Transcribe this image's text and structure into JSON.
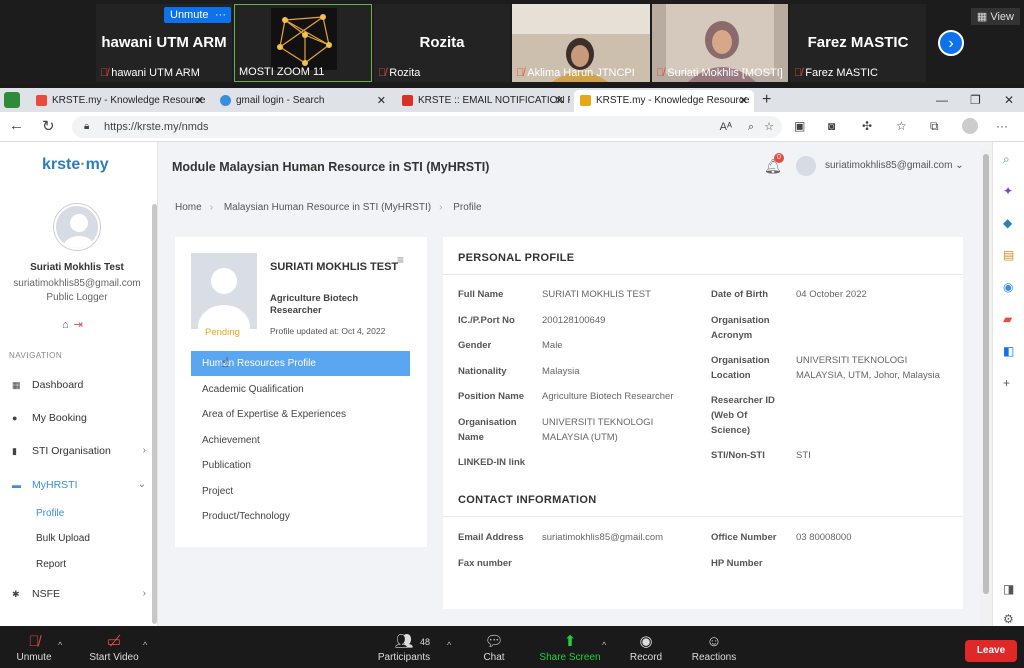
{
  "zoom_gallery": {
    "unmute_label": "Unmute",
    "more_label": "···",
    "view_label": "View",
    "tiles": [
      {
        "big_name": "hawani UTM ARM",
        "small_name": "hawani UTM ARM"
      },
      {
        "big_name": "",
        "small_name": "MOSTI ZOOM 11"
      },
      {
        "big_name": "Rozita",
        "small_name": "Rozita"
      },
      {
        "big_name": "",
        "small_name": "Aklima Harun JTNCPI"
      },
      {
        "big_name": "",
        "small_name": "Suriati Mokhlis [MOSTI]"
      },
      {
        "big_name": "Farez MASTIC",
        "small_name": "Farez MASTIC"
      }
    ]
  },
  "browser": {
    "tabs": [
      {
        "title": "KRSTE.my - Knowledge Resource",
        "fav_color": "#e74c3c"
      },
      {
        "title": "gmail login - Search",
        "fav_color": "#3a8de0"
      },
      {
        "title": "KRSTE :: EMAIL NOTIFICATION F",
        "fav_color": "#d93025"
      },
      {
        "title": "KRSTE.my - Knowledge Resource",
        "fav_color": "#e6a817"
      }
    ],
    "url": "https://krste.my/nmds"
  },
  "sidebar": {
    "logo": "krste",
    "logo_suffix": "my",
    "user_name": "Suriati Mokhlis Test",
    "user_email": "suriatimokhlis85@gmail.com",
    "user_role": "Public Logger",
    "nav_label": "NAVIGATION",
    "menu": [
      {
        "label": "Dashboard"
      },
      {
        "label": "My Booking"
      },
      {
        "label": "STI Organisation"
      },
      {
        "label": "MyHRSTI"
      },
      {
        "label": "NSFE"
      }
    ],
    "submenu": [
      "Profile",
      "Bulk Upload",
      "Report"
    ]
  },
  "header": {
    "module_title": "Module Malaysian Human Resource in STI (MyHRSTI)",
    "notif_count": "0",
    "user_email": "suriatimokhlis85@gmail.com"
  },
  "breadcrumb": [
    "Home",
    "Malaysian Human Resource in STI (MyHRSTI)",
    "Profile"
  ],
  "profile_card": {
    "name": "SURIATI MOKHLIS TEST",
    "title": "Agriculture Biotech Researcher",
    "status": "Pending",
    "updated": "Profile updated at: Oct 4, 2022",
    "links": [
      "Human Resources Profile",
      "Academic Qualification",
      "Area of Expertise & Experiences",
      "Achievement",
      "Publication",
      "Project",
      "Product/Technology"
    ]
  },
  "personal_profile": {
    "title": "PERSONAL PROFILE",
    "left": [
      {
        "label": "Full Name",
        "value": "SURIATI MOKHLIS TEST"
      },
      {
        "label": "IC./P.Port No",
        "value": "200128100649"
      },
      {
        "label": "Gender",
        "value": "Male"
      },
      {
        "label": "Nationality",
        "value": "Malaysia"
      },
      {
        "label": "Position Name",
        "value": "Agriculture Biotech Researcher"
      },
      {
        "label": "Organisation Name",
        "value": "UNIVERSITI TEKNOLOGI MALAYSIA (UTM)"
      },
      {
        "label": "LINKED-IN link",
        "value": ""
      }
    ],
    "right": [
      {
        "label": "Date of Birth",
        "value": "04 October 2022"
      },
      {
        "label": "Organisation Acronym",
        "value": ""
      },
      {
        "label": "Organisation Location",
        "value": "UNIVERSITI TEKNOLOGI MALAYSIA, UTM, Johor, Malaysia"
      },
      {
        "label": "Researcher ID (Web Of Science)",
        "value": ""
      },
      {
        "label": "STI/Non-STI",
        "value": "STI"
      }
    ]
  },
  "contact_info": {
    "title": "CONTACT INFORMATION",
    "left": [
      {
        "label": "Email Address",
        "value": "suriatimokhlis85@gmail.com"
      },
      {
        "label": "Fax number",
        "value": ""
      }
    ],
    "right": [
      {
        "label": "Office Number",
        "value": "03 80008000"
      },
      {
        "label": "HP Number",
        "value": ""
      }
    ]
  },
  "zoom_controls": {
    "unmute": "Unmute",
    "start_video": "Start Video",
    "participants": "Participants",
    "participant_count": "48",
    "chat": "Chat",
    "share_screen": "Share Screen",
    "record": "Record",
    "reactions": "Reactions",
    "leave": "Leave"
  },
  "colors": {
    "accent": "#3a8de0",
    "active_link": "#5aa6f0",
    "pending": "#e6a817",
    "leave": "#e02828",
    "zoom_blue": "#0e72ed"
  }
}
